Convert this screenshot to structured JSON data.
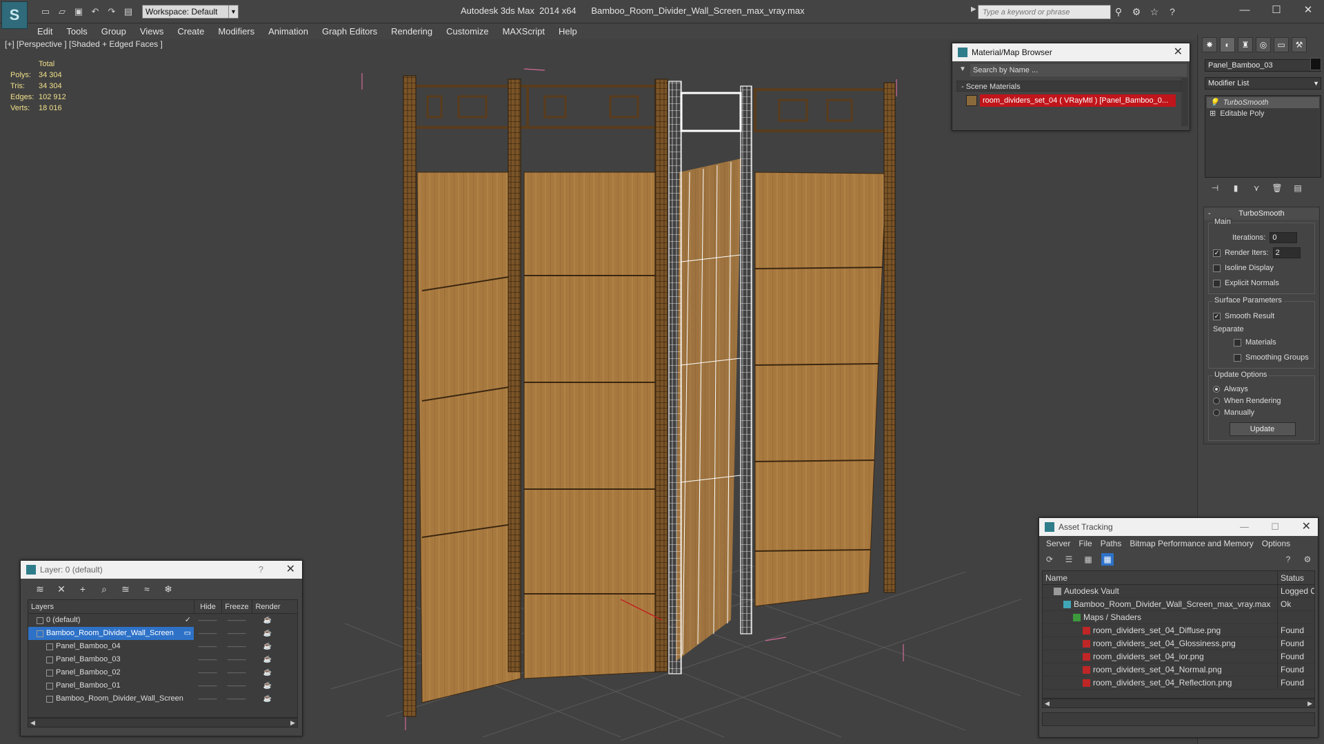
{
  "app": {
    "window_title": "Autodesk 3ds Max  2014 x64      Bamboo_Room_Divider_Wall_Screen_max_vray.max",
    "workspace": "Workspace: Default",
    "help_search_placeholder": "Type a keyword or phrase",
    "logo": "S"
  },
  "menu": [
    "Edit",
    "Tools",
    "Group",
    "Views",
    "Create",
    "Modifiers",
    "Animation",
    "Graph Editors",
    "Rendering",
    "Customize",
    "MAXScript",
    "Help"
  ],
  "viewport": {
    "label": "[+] [Perspective ] [Shaded + Edged Faces ]",
    "stats": {
      "header": "Total",
      "rows": [
        {
          "k": "Polys:",
          "v": "34 304"
        },
        {
          "k": "Tris:",
          "v": "34 304"
        },
        {
          "k": "Edges:",
          "v": "102 912"
        },
        {
          "k": "Verts:",
          "v": "18 016"
        }
      ]
    }
  },
  "command_panel": {
    "object_name": "Panel_Bamboo_03",
    "modifier_list": "Modifier List",
    "stack": [
      "TurboSmooth",
      "Editable Poly"
    ],
    "rollout_title": "TurboSmooth",
    "main_group": "Main",
    "iterations_label": "Iterations:",
    "iterations_value": "0",
    "render_iters_label": "Render Iters:",
    "render_iters_value": "2",
    "isoline_label": "Isoline Display",
    "explicit_normals_label": "Explicit Normals",
    "surface_params_label": "Surface Parameters",
    "smooth_result_label": "Smooth Result",
    "separate_label": "Separate",
    "materials_label": "Materials",
    "smoothing_groups_label": "Smoothing Groups",
    "update_options_label": "Update Options",
    "always_label": "Always",
    "when_rendering_label": "When Rendering",
    "manually_label": "Manually",
    "update_button": "Update"
  },
  "material_browser": {
    "title": "Material/Map Browser",
    "search_placeholder": "Search by Name ...",
    "section": "- Scene Materials",
    "item": "room_dividers_set_04 ( VRayMtl ) [Panel_Bamboo_0..."
  },
  "layers": {
    "title": "Layer: 0 (default)",
    "help": "?",
    "columns": [
      "Layers",
      "Hide",
      "Freeze",
      "Render"
    ],
    "rows": [
      {
        "name": "0 (default)",
        "indent": 1,
        "selected": false,
        "check": "✓"
      },
      {
        "name": "Bamboo_Room_Divider_Wall_Screen",
        "indent": 1,
        "selected": true,
        "check": "▭"
      },
      {
        "name": "Panel_Bamboo_04",
        "indent": 2,
        "selected": false,
        "check": ""
      },
      {
        "name": "Panel_Bamboo_03",
        "indent": 2,
        "selected": false,
        "check": ""
      },
      {
        "name": "Panel_Bamboo_02",
        "indent": 2,
        "selected": false,
        "check": ""
      },
      {
        "name": "Panel_Bamboo_01",
        "indent": 2,
        "selected": false,
        "check": ""
      },
      {
        "name": "Bamboo_Room_Divider_Wall_Screen",
        "indent": 2,
        "selected": false,
        "check": ""
      }
    ]
  },
  "asset_tracking": {
    "title": "Asset Tracking",
    "menu": [
      "Server",
      "File",
      "Paths",
      "Bitmap Performance and Memory",
      "Options"
    ],
    "columns": [
      "Name",
      "Status"
    ],
    "rows": [
      {
        "name": "Autodesk Vault",
        "indent": 1,
        "status": "Logged O"
      },
      {
        "name": "Bamboo_Room_Divider_Wall_Screen_max_vray.max",
        "indent": 2,
        "status": "Ok"
      },
      {
        "name": "Maps / Shaders",
        "indent": 3,
        "status": ""
      },
      {
        "name": "room_dividers_set_04_Diffuse.png",
        "indent": 4,
        "status": "Found"
      },
      {
        "name": "room_dividers_set_04_Glossiness.png",
        "indent": 4,
        "status": "Found"
      },
      {
        "name": "room_dividers_set_04_ior.png",
        "indent": 4,
        "status": "Found"
      },
      {
        "name": "room_dividers_set_04_Normal.png",
        "indent": 4,
        "status": "Found"
      },
      {
        "name": "room_dividers_set_04_Reflection.png",
        "indent": 4,
        "status": "Found"
      }
    ]
  },
  "colors": {
    "selection": "#2e72c8",
    "material_highlight": "#c0151b",
    "stats_text": "#f0e08a",
    "bamboo": "#a87a45",
    "bbox": "#d36a9a"
  }
}
